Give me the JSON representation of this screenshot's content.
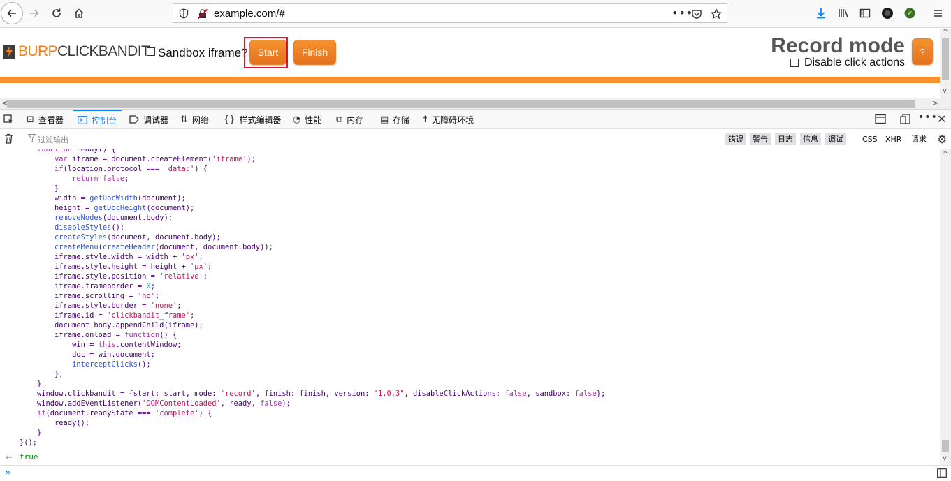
{
  "browser": {
    "url": "example.com/#",
    "icons": [
      "back-icon",
      "forward-icon",
      "reload-icon",
      "home-icon",
      "shield-icon",
      "insecure-lock-icon",
      "more-icon",
      "pocket-icon",
      "star-icon",
      "download-icon",
      "library-icon",
      "sidebar-icon",
      "avatar",
      "extension-icon",
      "menu-icon"
    ]
  },
  "page": {
    "logo_burp": "BURP",
    "logo_clickbandit": "CLICKBANDIT",
    "sandbox_label": "Sandbox iframe?",
    "start_label": "Start",
    "finish_label": "Finish",
    "record_title": "Record mode",
    "disable_label": "Disable click actions",
    "help_label": "?",
    "accent_color": "#f7922e",
    "highlight_color": "#e0152b"
  },
  "devtools": {
    "tabs": [
      {
        "label": "查看器",
        "icon": "inspector-icon"
      },
      {
        "label": "控制台",
        "icon": "console-icon",
        "active": true
      },
      {
        "label": "调试器",
        "icon": "debugger-icon"
      },
      {
        "label": "网络",
        "icon": "network-icon"
      },
      {
        "label": "样式编辑器",
        "icon": "style-editor-icon"
      },
      {
        "label": "性能",
        "icon": "performance-icon"
      },
      {
        "label": "内存",
        "icon": "memory-icon"
      },
      {
        "label": "存储",
        "icon": "storage-icon"
      },
      {
        "label": "无障碍环境",
        "icon": "accessibility-icon"
      }
    ],
    "filter_placeholder": "过滤输出",
    "filters": [
      "错误",
      "警告",
      "日志",
      "信息",
      "调试",
      "CSS",
      "XHR",
      "请求"
    ],
    "result": "true"
  }
}
